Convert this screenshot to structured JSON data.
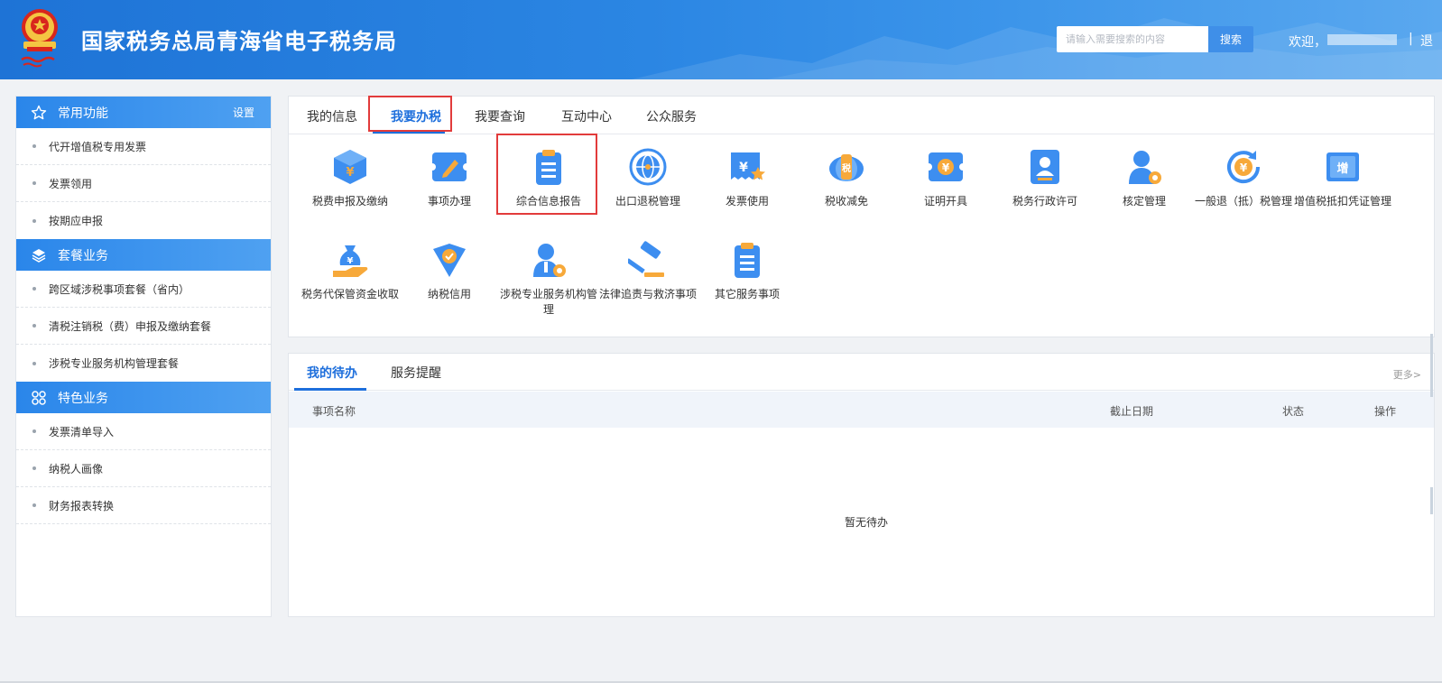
{
  "header": {
    "title": "国家税务总局青海省电子税务局",
    "search_placeholder": "请输入需要搜索的内容",
    "search_button": "搜索",
    "welcome": "欢迎，",
    "separator": "|",
    "logout": "退"
  },
  "sidebar": {
    "sections": [
      {
        "title": "常用功能",
        "icon": "star-icon",
        "action": "设置",
        "items": [
          "代开增值税专用发票",
          "发票领用",
          "按期应申报"
        ]
      },
      {
        "title": "套餐业务",
        "icon": "layers-icon",
        "items": [
          "跨区域涉税事项套餐（省内）",
          "清税注销税（费）申报及缴纳套餐",
          "涉税专业服务机构管理套餐"
        ]
      },
      {
        "title": "特色业务",
        "icon": "grid-icon",
        "items": [
          "发票清单导入",
          "纳税人画像",
          "财务报表转换"
        ]
      }
    ]
  },
  "main": {
    "tabs": [
      "我的信息",
      "我要办税",
      "我要查询",
      "互动中心",
      "公众服务"
    ],
    "active_tab": "我要办税",
    "services_row1": [
      {
        "label": "税费申报及缴纳",
        "icon": "declaration-icon"
      },
      {
        "label": "事项办理",
        "icon": "pencil-ticket-icon"
      },
      {
        "label": "综合信息报告",
        "icon": "clipboard-icon"
      },
      {
        "label": "出口退税管理",
        "icon": "globe-icon"
      },
      {
        "label": "发票使用",
        "icon": "invoice-star-icon"
      },
      {
        "label": "税收减免",
        "icon": "tax-reduction-icon"
      },
      {
        "label": "证明开具",
        "icon": "certificate-icon"
      },
      {
        "label": "税务行政许可",
        "icon": "admin-permit-icon"
      },
      {
        "label": "核定管理",
        "icon": "person-gear-icon"
      },
      {
        "label": "一般退（抵）税管理",
        "icon": "refund-cycle-icon"
      },
      {
        "label": "增值税抵扣凭证管理",
        "icon": "vat-voucher-icon"
      }
    ],
    "services_row2": [
      {
        "label": "税务代保管资金收取",
        "icon": "money-bag-hand-icon"
      },
      {
        "label": "纳税信用",
        "icon": "credit-shield-icon"
      },
      {
        "label": "涉税专业服务机构管理",
        "icon": "agent-gear-icon"
      },
      {
        "label": "法律追责与救济事项",
        "icon": "gavel-icon"
      },
      {
        "label": "其它服务事项",
        "icon": "other-clipboard-icon"
      }
    ]
  },
  "todo": {
    "tabs": [
      "我的待办",
      "服务提醒"
    ],
    "more": "更多>",
    "columns": [
      "事项名称",
      "截止日期",
      "状态",
      "操作"
    ],
    "empty": "暂无待办"
  },
  "colors": {
    "primary": "#1e6fdc",
    "header": "#2b86e3",
    "highlight_box": "#e23b3b",
    "icon_blue": "#3d8ef0",
    "icon_orange": "#f7a93a"
  }
}
